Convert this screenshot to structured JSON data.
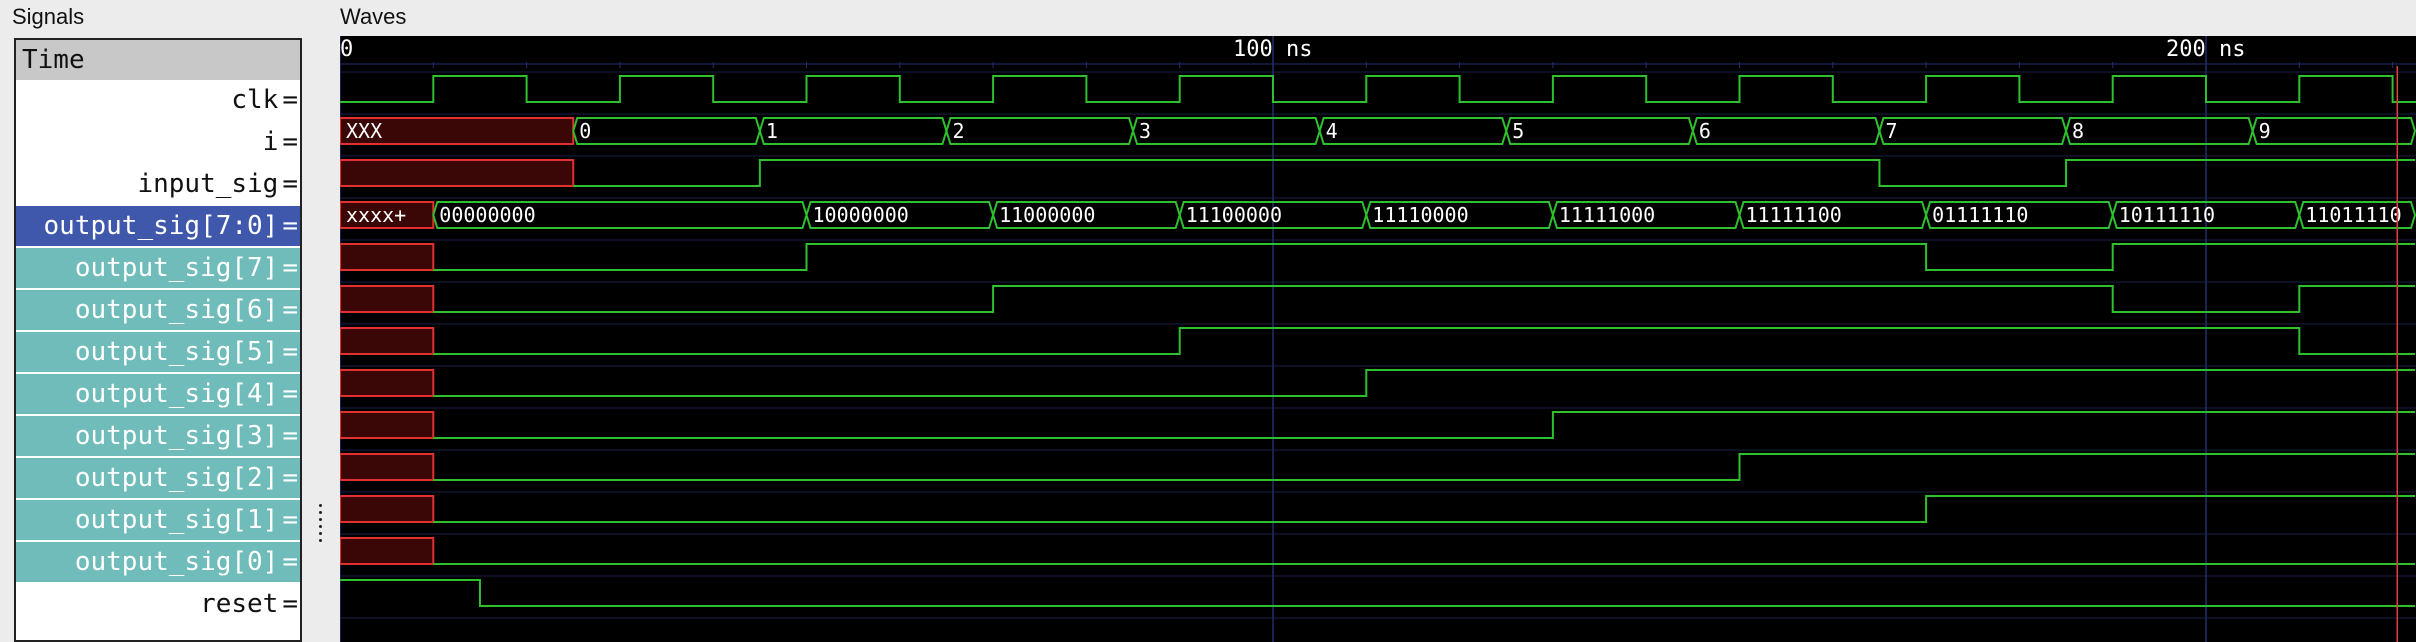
{
  "panes": {
    "signals_title": "Signals",
    "waves_title": "Waves"
  },
  "time_header": "Time",
  "timescale": {
    "labels": [
      {
        "t": 0,
        "text": "0"
      },
      {
        "t": 100,
        "text": "100 ns"
      },
      {
        "t": 200,
        "text": "200 ns"
      }
    ],
    "view_end_ns": 222.5,
    "cursor_ns": 220.5
  },
  "signals": [
    {
      "label": "clk",
      "style": "plain"
    },
    {
      "label": "i",
      "style": "plain"
    },
    {
      "label": "input_sig",
      "style": "plain"
    },
    {
      "label": "output_sig[7:0]",
      "style": "selected"
    },
    {
      "label": "output_sig[7]",
      "style": "child"
    },
    {
      "label": "output_sig[6]",
      "style": "child"
    },
    {
      "label": "output_sig[5]",
      "style": "child"
    },
    {
      "label": "output_sig[4]",
      "style": "child"
    },
    {
      "label": "output_sig[3]",
      "style": "child"
    },
    {
      "label": "output_sig[2]",
      "style": "child"
    },
    {
      "label": "output_sig[1]",
      "style": "child"
    },
    {
      "label": "output_sig[0]",
      "style": "child"
    },
    {
      "label": "reset",
      "style": "plain"
    }
  ],
  "waves": {
    "clk": {
      "period_ns": 20,
      "high_start_ns": 10,
      "first_low_ns": 0
    },
    "i": [
      {
        "start": 0,
        "end": 25,
        "value": "XXX",
        "unknown": true
      },
      {
        "start": 25,
        "end": 45,
        "value": "0"
      },
      {
        "start": 45,
        "end": 65,
        "value": "1"
      },
      {
        "start": 65,
        "end": 85,
        "value": "2"
      },
      {
        "start": 85,
        "end": 105,
        "value": "3"
      },
      {
        "start": 105,
        "end": 125,
        "value": "4"
      },
      {
        "start": 125,
        "end": 145,
        "value": "5"
      },
      {
        "start": 145,
        "end": 165,
        "value": "6"
      },
      {
        "start": 165,
        "end": 185,
        "value": "7"
      },
      {
        "start": 185,
        "end": 205,
        "value": "8"
      },
      {
        "start": 205,
        "end": 222.5,
        "value": "9"
      }
    ],
    "input_sig": [
      {
        "start": 0,
        "end": 25,
        "level": "x"
      },
      {
        "start": 25,
        "end": 45,
        "level": 0
      },
      {
        "start": 45,
        "end": 165,
        "level": 1
      },
      {
        "start": 165,
        "end": 185,
        "level": 0
      },
      {
        "start": 185,
        "end": 222.5,
        "level": 1
      }
    ],
    "output_bus": [
      {
        "start": 0,
        "end": 10,
        "value": "xxxx+",
        "unknown": true
      },
      {
        "start": 10,
        "end": 50,
        "value": "00000000"
      },
      {
        "start": 50,
        "end": 70,
        "value": "10000000"
      },
      {
        "start": 70,
        "end": 90,
        "value": "11000000"
      },
      {
        "start": 90,
        "end": 110,
        "value": "11100000"
      },
      {
        "start": 110,
        "end": 130,
        "value": "11110000"
      },
      {
        "start": 130,
        "end": 150,
        "value": "11111000"
      },
      {
        "start": 150,
        "end": 170,
        "value": "11111100"
      },
      {
        "start": 170,
        "end": 190,
        "value": "01111110"
      },
      {
        "start": 190,
        "end": 210,
        "value": "10111110"
      },
      {
        "start": 210,
        "end": 222.5,
        "value": "11011110"
      }
    ],
    "bits": [
      [
        {
          "start": 0,
          "end": 10,
          "level": "x"
        },
        {
          "start": 10,
          "end": 50,
          "level": 0
        },
        {
          "start": 50,
          "end": 170,
          "level": 1
        },
        {
          "start": 170,
          "end": 190,
          "level": 0
        },
        {
          "start": 190,
          "end": 222.5,
          "level": 1
        }
      ],
      [
        {
          "start": 0,
          "end": 10,
          "level": "x"
        },
        {
          "start": 10,
          "end": 70,
          "level": 0
        },
        {
          "start": 70,
          "end": 190,
          "level": 1
        },
        {
          "start": 190,
          "end": 210,
          "level": 0
        },
        {
          "start": 210,
          "end": 222.5,
          "level": 1
        }
      ],
      [
        {
          "start": 0,
          "end": 10,
          "level": "x"
        },
        {
          "start": 10,
          "end": 90,
          "level": 0
        },
        {
          "start": 90,
          "end": 210,
          "level": 1
        },
        {
          "start": 210,
          "end": 222.5,
          "level": 0
        }
      ],
      [
        {
          "start": 0,
          "end": 10,
          "level": "x"
        },
        {
          "start": 10,
          "end": 110,
          "level": 0
        },
        {
          "start": 110,
          "end": 222.5,
          "level": 1
        }
      ],
      [
        {
          "start": 0,
          "end": 10,
          "level": "x"
        },
        {
          "start": 10,
          "end": 130,
          "level": 0
        },
        {
          "start": 130,
          "end": 222.5,
          "level": 1
        }
      ],
      [
        {
          "start": 0,
          "end": 10,
          "level": "x"
        },
        {
          "start": 10,
          "end": 150,
          "level": 0
        },
        {
          "start": 150,
          "end": 222.5,
          "level": 1
        }
      ],
      [
        {
          "start": 0,
          "end": 10,
          "level": "x"
        },
        {
          "start": 10,
          "end": 170,
          "level": 0
        },
        {
          "start": 170,
          "end": 222.5,
          "level": 1
        }
      ],
      [
        {
          "start": 0,
          "end": 10,
          "level": "x"
        },
        {
          "start": 10,
          "end": 222.5,
          "level": 0
        }
      ]
    ],
    "reset": [
      {
        "start": 0,
        "end": 15,
        "level": 1
      },
      {
        "start": 15,
        "end": 222.5,
        "level": 0
      }
    ]
  },
  "colors": {
    "wave": "#2ec02e",
    "unknown_stroke": "#e03030",
    "unknown_fill": "#3a0606",
    "grid": "#232d6e",
    "cursor": "#e04040",
    "text_on_dark": "#ffffff",
    "background": "#000000"
  }
}
